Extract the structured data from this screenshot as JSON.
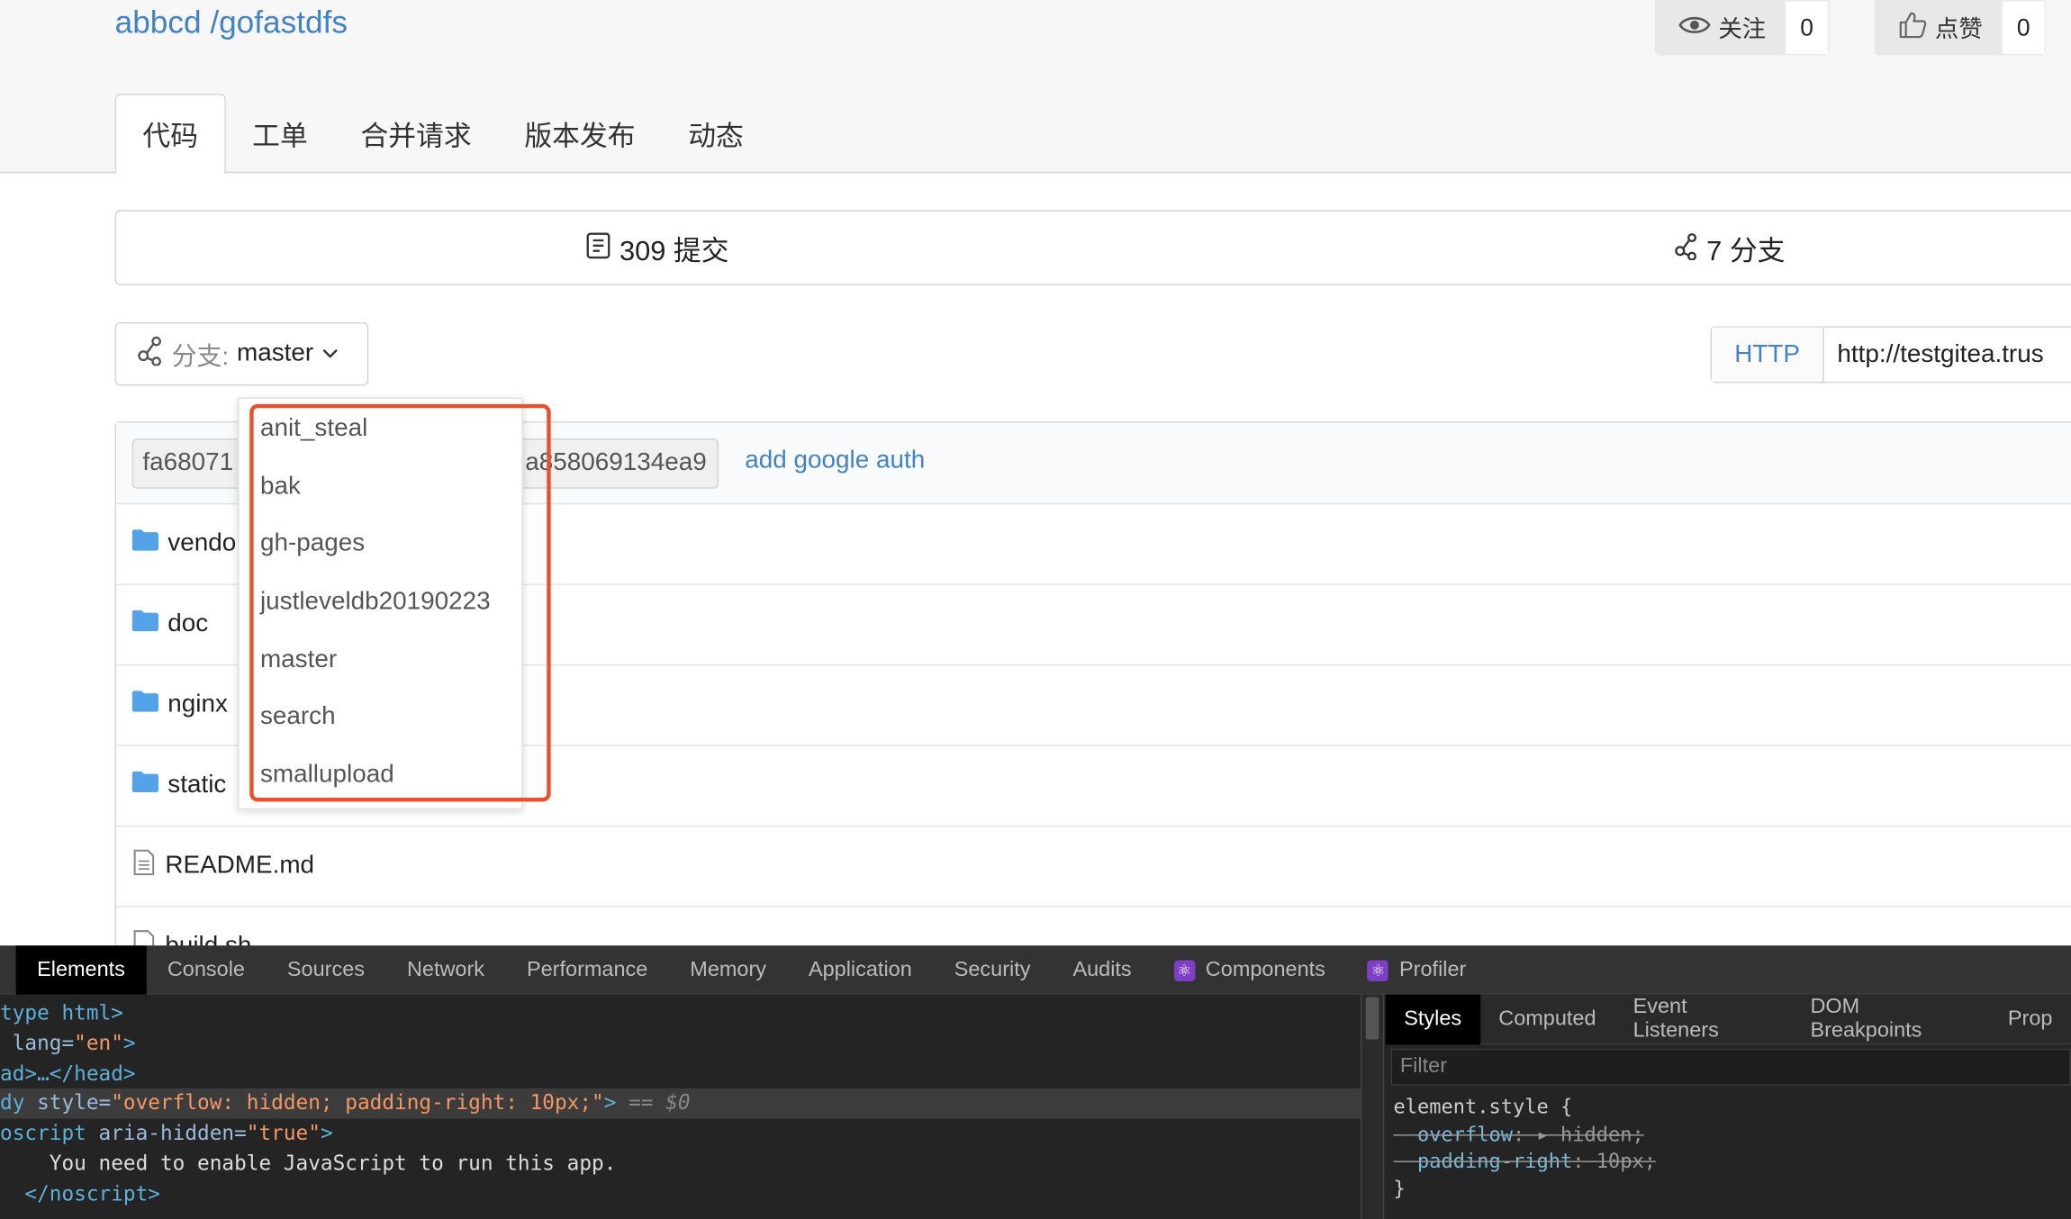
{
  "repo": {
    "owner": "abbcd",
    "separator": " /",
    "name": "gofastdfs"
  },
  "watch": {
    "label": "关注",
    "count": "0",
    "icon": "eye-icon"
  },
  "star": {
    "label": "点赞",
    "count": "0",
    "icon": "thumbs-up-icon"
  },
  "tabs": [
    {
      "label": "代码",
      "active": true
    },
    {
      "label": "工单"
    },
    {
      "label": "合并请求"
    },
    {
      "label": "版本发布"
    },
    {
      "label": "动态"
    }
  ],
  "stats": {
    "commits": {
      "icon": "commit-icon",
      "label": "309 提交"
    },
    "branches": {
      "icon": "branch-icon",
      "label": "7 分支"
    }
  },
  "branch_selector": {
    "prefix": "分支:",
    "value": "master",
    "icon": "branch-icon"
  },
  "clone": {
    "protocol": "HTTP",
    "url": "http://testgitea.trus"
  },
  "commit": {
    "sha_start": "fa68071",
    "sha_end": "a858069134ea9",
    "message": "add google auth"
  },
  "files": [
    {
      "name": "vendo",
      "type": "folder"
    },
    {
      "name": "doc",
      "type": "folder"
    },
    {
      "name": "nginx",
      "type": "folder"
    },
    {
      "name": "static",
      "type": "folder"
    },
    {
      "name": "README.md",
      "type": "file"
    },
    {
      "name": "build.sh",
      "type": "file"
    }
  ],
  "branches_dropdown": [
    "anit_steal",
    "bak",
    "gh-pages",
    "justleveldb20190223",
    "master",
    "search",
    "smallupload"
  ],
  "colors": {
    "link": "#4183c4",
    "highlight": "#e5522c",
    "devtools_bg": "#242424"
  },
  "devtools": {
    "tabs": [
      "Elements",
      "Console",
      "Sources",
      "Network",
      "Performance",
      "Memory",
      "Application",
      "Security",
      "Audits",
      "Components",
      "Profiler"
    ],
    "code": {
      "l1": "type html>",
      "l2_attr": " lang=",
      "l2_val": "\"en\"",
      "l2_end": ">",
      "l3": "ad>…</head>",
      "l4_tag": "dy",
      "l4_attr": " style=",
      "l4_val": "\"overflow: hidden; padding-right: 10px;\"",
      "l4_end": ">",
      "l4_ref": " == $0",
      "l5_tag": "oscript",
      "l5_attr": " aria-hidden=",
      "l5_val": "\"true\"",
      "l5_end": ">",
      "l6": "    You need to enable JavaScript to run this app.",
      "l7": "  </noscript>"
    },
    "side_tabs": [
      "Styles",
      "Computed",
      "Event Listeners",
      "DOM Breakpoints",
      "Prop"
    ],
    "filter_placeholder": "Filter",
    "styles": {
      "selector": "element.style {",
      "p1_name": "overflow",
      "p1_val": ": ▸ hidden;",
      "p2_name": "padding-right",
      "p2_val": ": 10px;",
      "close": "}"
    }
  }
}
